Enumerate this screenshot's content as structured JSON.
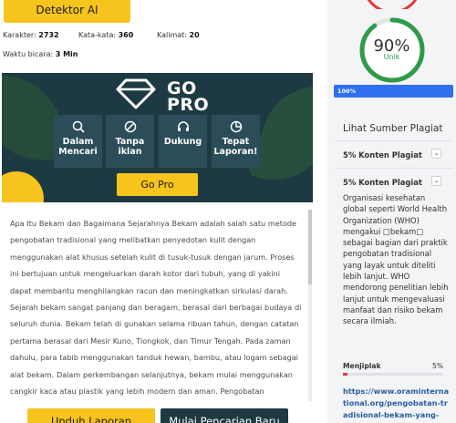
{
  "detector_button": "Detektor AI",
  "stats": {
    "chars_label": "Karakter:",
    "chars_value": "2732",
    "words_label": "Kata-kata:",
    "words_value": "360",
    "sentences_label": "Kalimat:",
    "sentences_value": "20",
    "speak_label": "Waktu bicara:",
    "speak_value": "3 Min"
  },
  "promo": {
    "title_line1": "GO",
    "title_line2": "PRO",
    "features": [
      {
        "icon": "search-icon",
        "line1": "Dalam",
        "line2": "Mencari"
      },
      {
        "icon": "no-ads-icon",
        "line1": "Tanpa",
        "line2": "iklan"
      },
      {
        "icon": "headset-icon",
        "line1": "Dukung",
        "line2": ""
      },
      {
        "icon": "pie-chart-icon",
        "line1": "Tepat",
        "line2": "Laporan!"
      }
    ],
    "button": "Go Pro",
    "colors": {
      "background": "#1d3a43",
      "accent": "#f6c41c",
      "tile": "#2b4c58"
    }
  },
  "article": {
    "text": "Apa Itu Bekam dan Bagaimana Sejarahnya Bekam adalah salah satu metode pengobatan tradisional yang melibatkan penyedotan kulit dengan menggunakan alat khusus setelah kulit di tusuk-tusuk dengan jarum. Proses ini bertujuan untuk mengeluarkan darah kotor dari tubuh, yang di yakini dapat membantu menghilangkan racun dan meningkatkan sirkulasi darah. Sejarah bekam sangat panjang dan beragam, berasal dari berbagai budaya di seluruh dunia. Bekam telah di gunakan selama ribuan tahun, dengan catatan pertama berasal dari Mesir Kuno, Tiongkok, dan Timur Tengah. Pada zaman dahulu, para tabib menggunakan tanduk hewan, bambu, atau logam sebagai alat bekam. Dalam perkembangan selanjutnya, bekam mulai menggunakan cangkir kaca atau plastik yang lebih modern dan aman. Pengobatan Tradisional Bekam menjadi populer di dunia Barat pada abad ke-20 setelah diperkenalkan oleh"
  },
  "bottom_buttons": {
    "upload": "Unduh Laporan",
    "new_search": "Mulai Pencarian Baru"
  },
  "result": {
    "percent": "90%",
    "percent_value": 90,
    "label": "Unik",
    "progress_label": "100%",
    "progress_value": 100,
    "colors": {
      "gauge": "#2e9b48",
      "top_gauge": "#e53935",
      "progress": "#2f6ff0"
    }
  },
  "sources": {
    "title": "Lihat Sumber Plagiat",
    "item1_label": "5% Konten Plagiat",
    "item2_label": "5% Konten Plagiat",
    "org_text": "Organisasi kesehatan global seperti World Health Organization (WHO) mengakui □bekam□ sebagai bagian dari praktik pengobatan tradisional yang layak untuk diteliti lebih lanjut. WHO mendorong penelitian lebih lanjut untuk mengevaluasi manfaat dan risiko bekam secara ilmiah.",
    "copy_label": "Menjiplak",
    "copy_percent": "5%",
    "copy_value": 5,
    "link": "https://www.oraminternational.org/pengobatan-tradisional-bekam-yang-"
  }
}
